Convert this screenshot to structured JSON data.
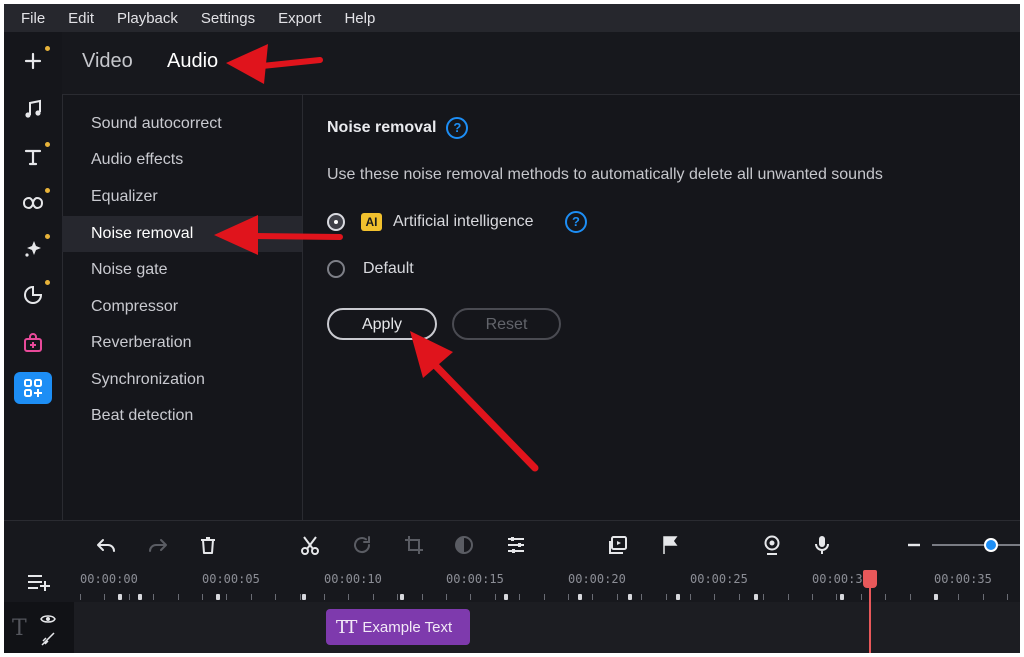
{
  "menu": [
    "File",
    "Edit",
    "Playback",
    "Settings",
    "Export",
    "Help"
  ],
  "tabs": {
    "video": "Video",
    "audio": "Audio"
  },
  "settings_list": [
    "Sound autocorrect",
    "Audio effects",
    "Equalizer",
    "Noise removal",
    "Noise gate",
    "Compressor",
    "Reverberation",
    "Synchronization",
    "Beat detection"
  ],
  "noise_removal": {
    "title": "Noise removal",
    "help_glyph": "?",
    "description": "Use these noise removal methods to automatically delete all unwanted sounds",
    "options": [
      {
        "badge": "AI",
        "label": "Artificial intelligence",
        "checked": true
      },
      {
        "label": "Default",
        "checked": false
      }
    ],
    "apply_label": "Apply",
    "reset_label": "Reset"
  },
  "timeline": {
    "time_labels": [
      "00:00:00",
      "00:00:05",
      "00:00:10",
      "00:00:15",
      "00:00:20",
      "00:00:25",
      "00:00:3",
      "00:00:35"
    ],
    "clip_icon": "TT",
    "clip_label": "Example Text",
    "track_type_glyph": "T"
  },
  "colors": {
    "accent": "#1d8ef5",
    "annotation_arrow": "#e0141c",
    "playhead": "#e8585a",
    "ai_badge": "#f2c12e",
    "text_clip": "#7e3aad",
    "notification_dot": "#e8b33a"
  },
  "icons": {
    "toolbar": [
      "plus-icon",
      "music-note-icon",
      "text-icon",
      "transitions-icon",
      "sparkle-icon",
      "sticker-icon",
      "store-bag-icon",
      "more-tools-icon"
    ],
    "timeline": [
      "undo-icon",
      "redo-icon",
      "delete-icon",
      "cut-icon",
      "rotate-icon",
      "crop-icon",
      "color-adjust-icon",
      "clip-properties-icon",
      "slideshow-icon",
      "flag-marker-icon",
      "webcam-icon",
      "microphone-icon",
      "zoom-out-icon",
      "add-track-icon",
      "eye-icon",
      "unlink-icon"
    ]
  }
}
